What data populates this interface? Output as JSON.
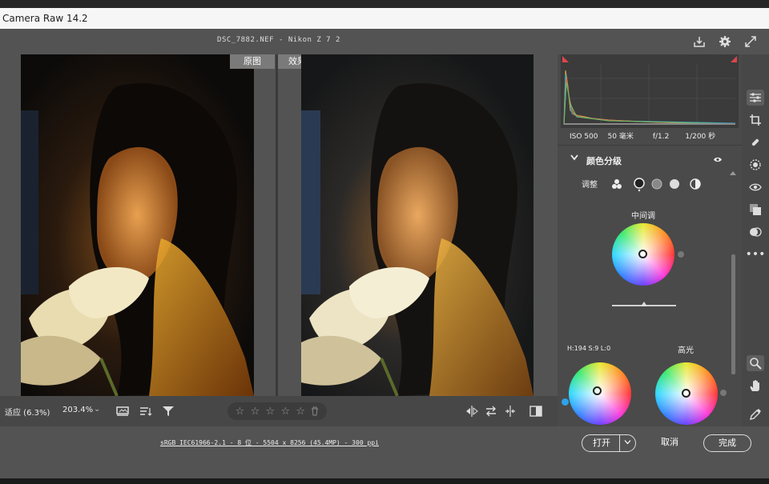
{
  "window": {
    "title": "Camera Raw 14.2"
  },
  "file": {
    "name": "DSC_7882.NEF -  Nikon Z 7 2"
  },
  "viewer": {
    "before_label": "原图",
    "after_label": "效果图"
  },
  "toolbar": {
    "fit_label": "适应 (6.3%)",
    "zoom_value": "203.4%",
    "zoom_dropdown": "⌄",
    "stars": [
      "☆",
      "☆",
      "☆",
      "☆",
      "☆"
    ]
  },
  "panel": {
    "exif": {
      "iso": "ISO 500",
      "focal": "50 毫米",
      "aperture": "f/1.2",
      "shutter": "1/200 秒"
    },
    "section_title": "颜色分级",
    "adjust_label": "调整",
    "midtones_label": "中间调",
    "hsl_readout": "H:194 S:9   L:0",
    "highlights_label": "高光"
  },
  "status": {
    "metadata": "sRGB IEC61966-2.1 - 8 位 - 5504 x 8256 (45.4MP) - 300 ppi",
    "open_label": "打开",
    "cancel_label": "取消",
    "done_label": "完成"
  },
  "colors": {
    "accent_blue": "#2ea3e8",
    "clip_red": "#e0444c",
    "title_bg": "#f6f6f6"
  },
  "icons": {
    "top": [
      "save-icon",
      "gear-icon",
      "expand-icon"
    ],
    "rail": [
      "edit-sliders-icon",
      "crop-icon",
      "healing-icon",
      "mask-icon",
      "redeye-icon",
      "presets-icon",
      "snapshots-icon",
      "more-icon",
      "zoom-icon",
      "hand-icon",
      "color-sampler-icon",
      "grid-icon"
    ]
  }
}
